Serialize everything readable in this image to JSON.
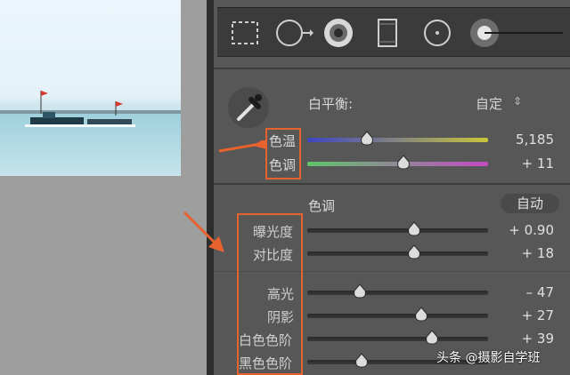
{
  "white_balance": {
    "label": "白平衡:",
    "preset": "自定",
    "preset_chevron": "⇕",
    "sliders": [
      {
        "label": "色温",
        "value": "5,185",
        "level": 0.33
      },
      {
        "label": "色调",
        "value": "+ 11",
        "level": 0.53
      }
    ]
  },
  "tone": {
    "section_label": "色调",
    "auto_label": "自动",
    "sliders": [
      {
        "label": "曝光度",
        "value": "+ 0.90",
        "level": 0.59
      },
      {
        "label": "对比度",
        "value": "+ 18",
        "level": 0.59
      },
      {
        "label": "高光",
        "value": "– 47",
        "level": 0.29
      },
      {
        "label": "阴影",
        "value": "+ 27",
        "level": 0.63
      },
      {
        "label": "白色色阶",
        "value": "+ 39",
        "level": 0.69
      },
      {
        "label": "黑色色阶",
        "value": "",
        "level": 0.3
      }
    ]
  },
  "watermark": "头条 @摄影自学班",
  "colors": {
    "annotation": "#e8622e",
    "panel_bg": "#575757",
    "temp_track_start": "#3f45c4",
    "temp_track_end": "#c9c53a",
    "tint_track_start": "#5fc46a",
    "tint_track_end": "#c44ac4"
  },
  "icons": [
    "marquee-crop-icon",
    "spot-removal-icon",
    "red-eye-icon",
    "graduated-filter-icon",
    "radial-filter-icon",
    "adjustment-brush-icon",
    "eyedropper-icon"
  ]
}
